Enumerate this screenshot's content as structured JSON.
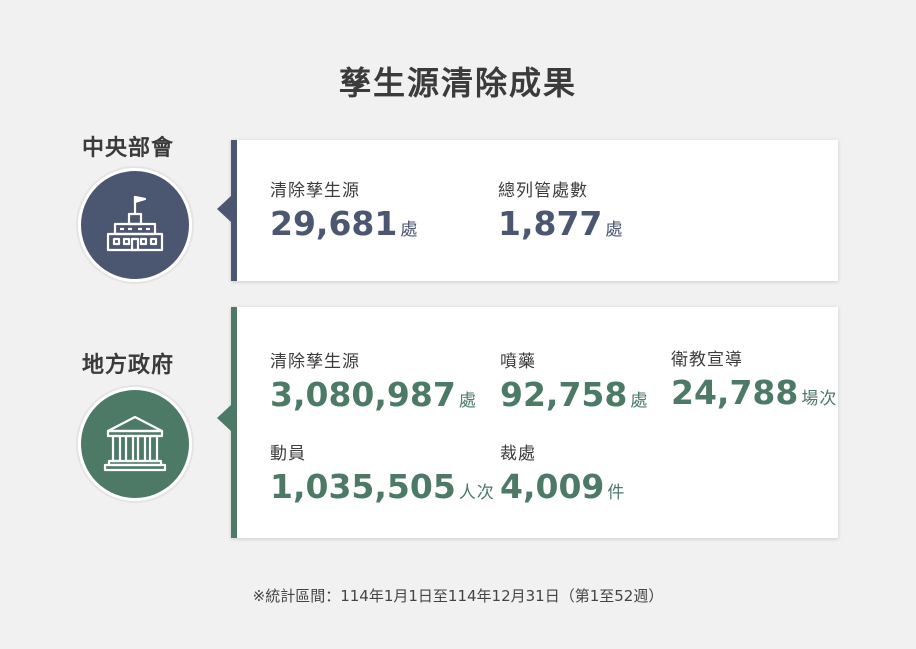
{
  "title": "孳生源清除成果",
  "colors": {
    "central": "#4b5670",
    "local": "#4c7a67",
    "background": "#f1f1f1"
  },
  "central": {
    "label": "中央部會",
    "icon": "government-building-icon",
    "stats": [
      {
        "label": "清除孳生源",
        "value": "29,681",
        "unit": "處"
      },
      {
        "label": "總列管處數",
        "value": "1,877",
        "unit": "處"
      }
    ]
  },
  "local": {
    "label": "地方政府",
    "icon": "classical-building-icon",
    "stats": [
      {
        "label": "清除孳生源",
        "value": "3,080,987",
        "unit": "處"
      },
      {
        "label": "噴藥",
        "value": "92,758",
        "unit": "處"
      },
      {
        "label": "衛教宣導",
        "value": "24,788",
        "unit": "場次"
      },
      {
        "label": "動員",
        "value": "1,035,505",
        "unit": "人次"
      },
      {
        "label": "裁處",
        "value": "4,009",
        "unit": "件"
      }
    ]
  },
  "footnote": "※統計區間：114年1月1日至114年12月31日（第1至52週）"
}
